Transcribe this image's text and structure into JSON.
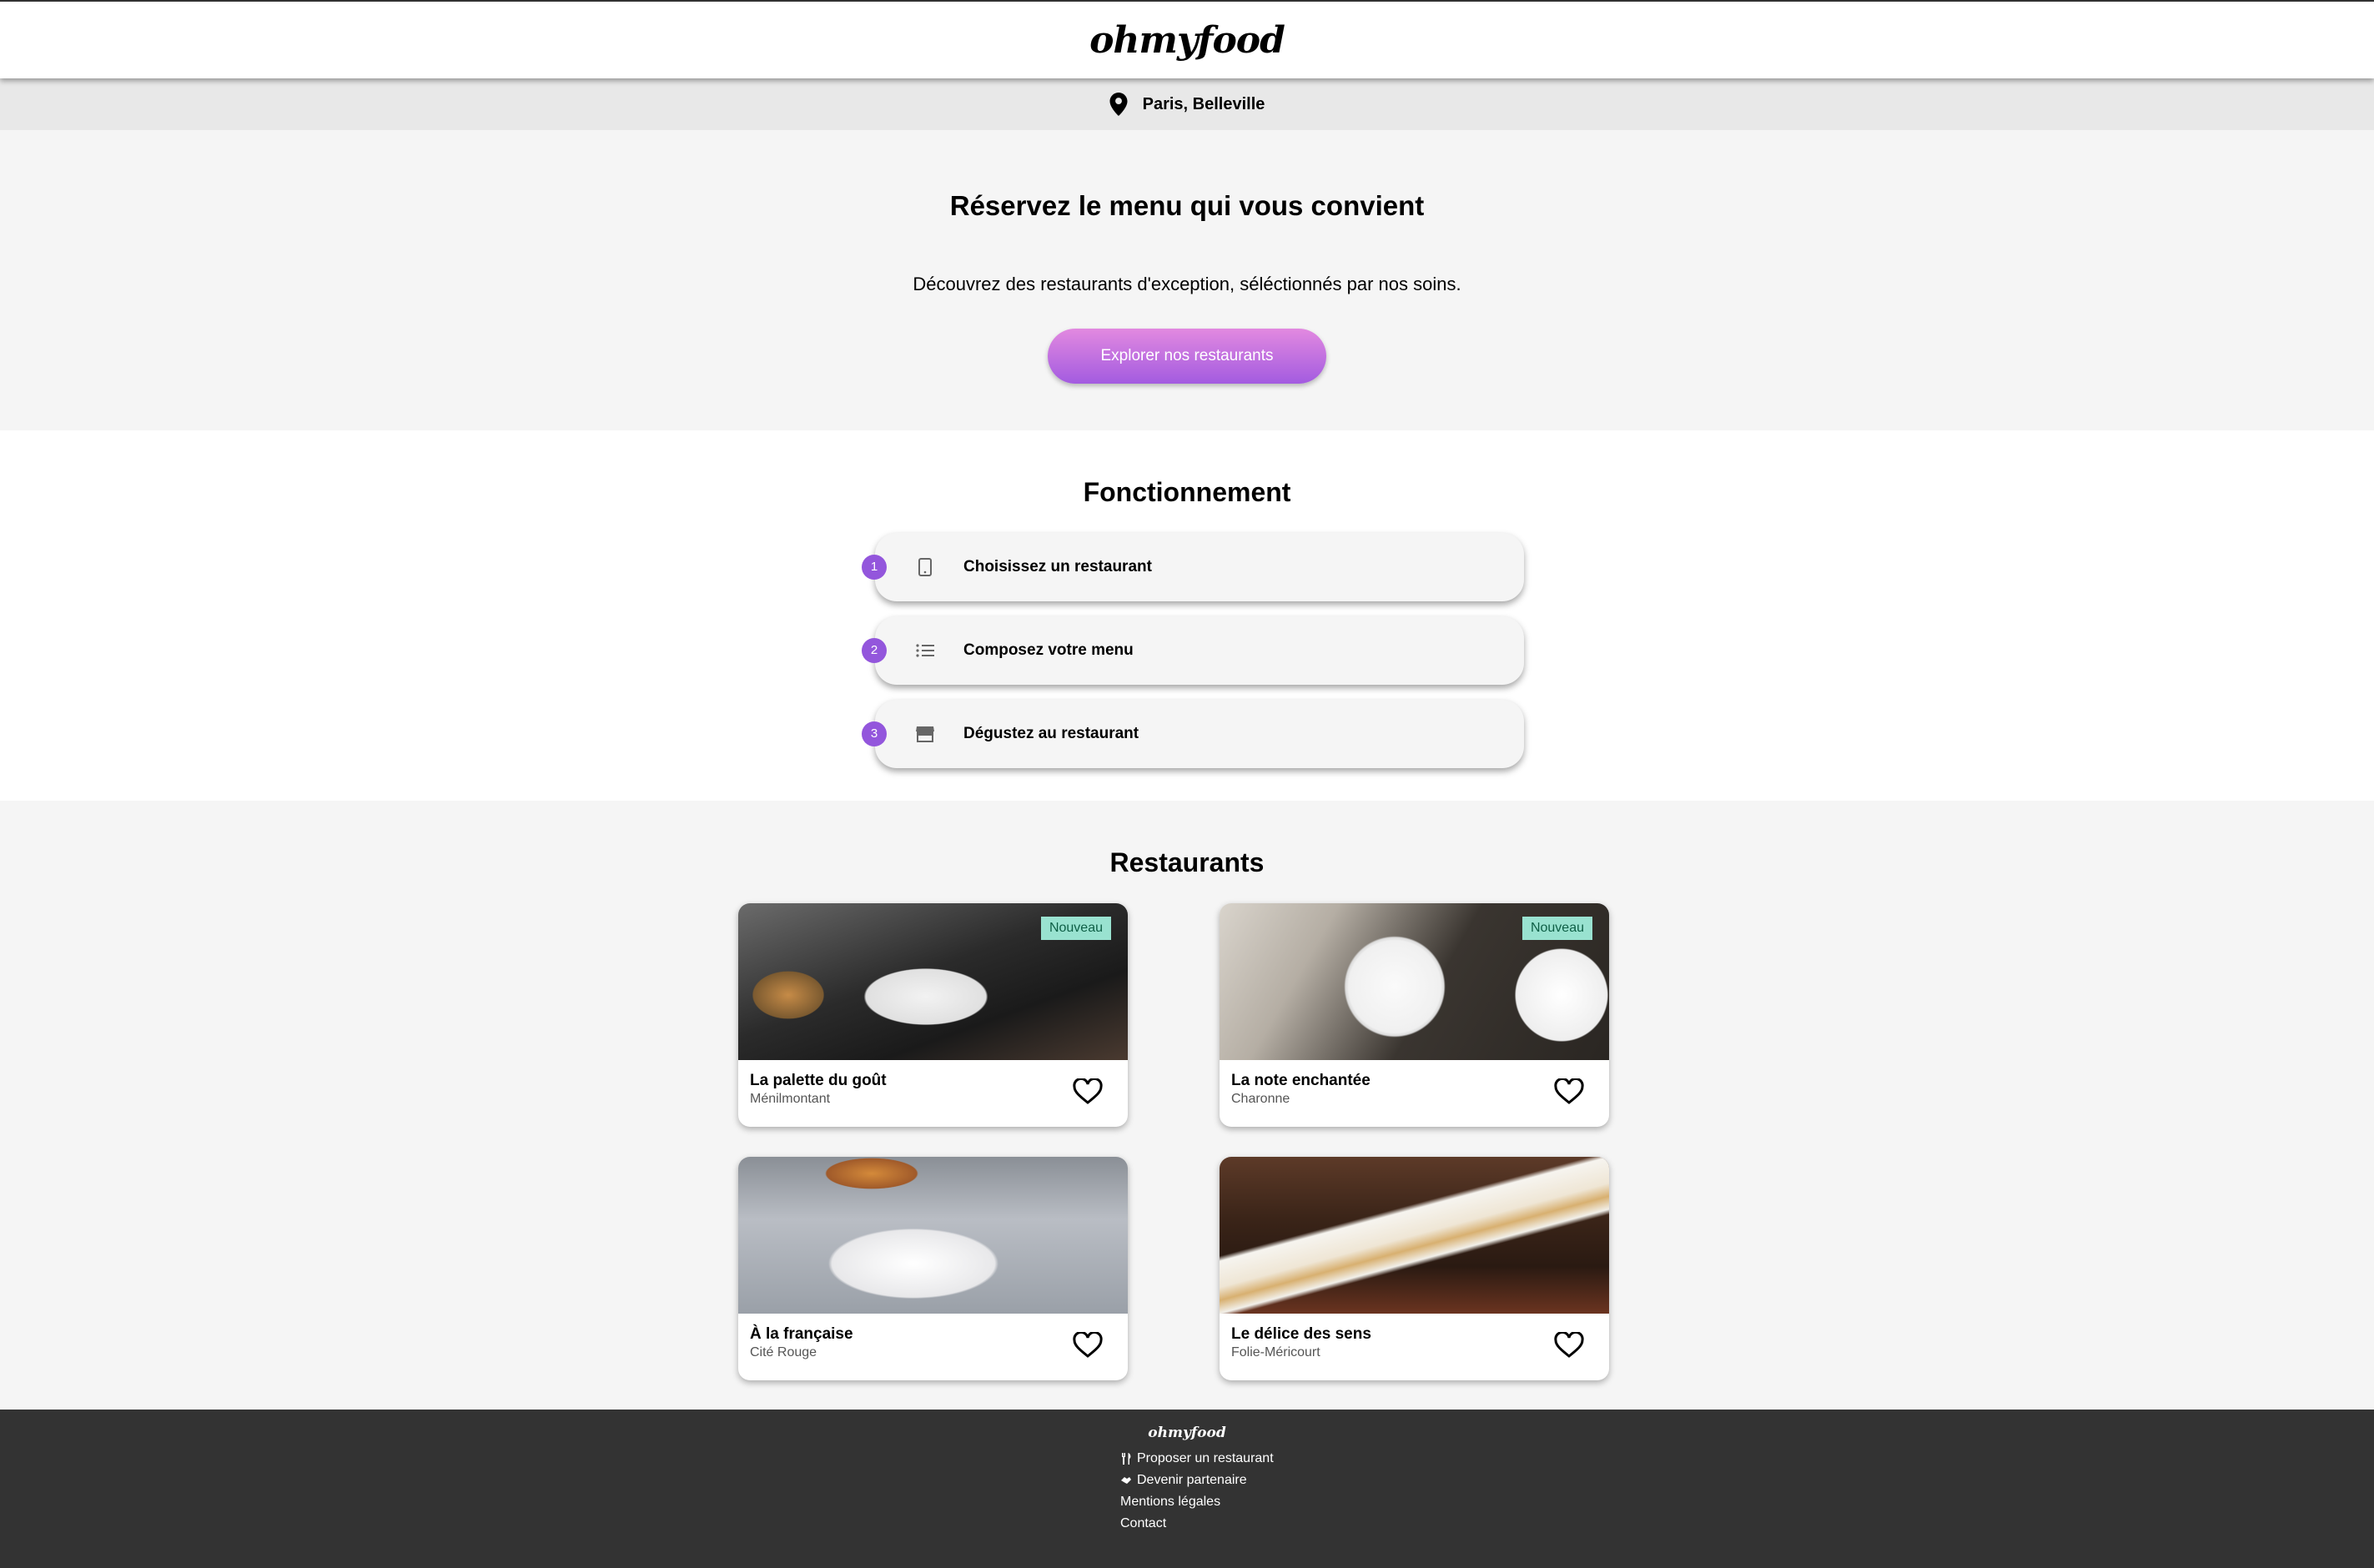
{
  "header": {
    "logo": "ohmyfood"
  },
  "location": {
    "label": "Paris, Belleville",
    "icon": "map-pin-icon"
  },
  "hero": {
    "title": "Réservez le menu qui vous convient",
    "subtitle": "Découvrez des restaurants d'exception, séléctionnés par nos soins.",
    "cta_label": "Explorer nos restaurants"
  },
  "how": {
    "title": "Fonctionnement",
    "steps": [
      {
        "number": "1",
        "icon": "mobile-phone-icon",
        "label": "Choisissez un restaurant"
      },
      {
        "number": "2",
        "icon": "list-icon",
        "label": "Composez votre menu"
      },
      {
        "number": "3",
        "icon": "store-icon",
        "label": "Dégustez au restaurant"
      }
    ]
  },
  "restaurants": {
    "title": "Restaurants",
    "items": [
      {
        "name": "La palette du goût",
        "area": "Ménilmontant",
        "badge": "Nouveau"
      },
      {
        "name": "La note enchantée",
        "area": "Charonne",
        "badge": "Nouveau"
      },
      {
        "name": "À la française",
        "area": "Cité Rouge",
        "badge": ""
      },
      {
        "name": "Le délice des sens",
        "area": "Folie-Méricourt",
        "badge": ""
      }
    ]
  },
  "footer": {
    "logo": "ohmyfood",
    "links": [
      {
        "label": "Proposer un restaurant",
        "icon": "utensils-icon"
      },
      {
        "label": "Devenir partenaire",
        "icon": "handshake-icon"
      },
      {
        "label": "Mentions légales",
        "icon": ""
      },
      {
        "label": "Contact",
        "icon": ""
      }
    ]
  },
  "colors": {
    "accent_purple": "#9356dc",
    "cta_gradient_start": "#e289e0",
    "cta_gradient_end": "#a35be0",
    "badge_bg": "#99e2d0",
    "footer_bg": "#333333"
  }
}
